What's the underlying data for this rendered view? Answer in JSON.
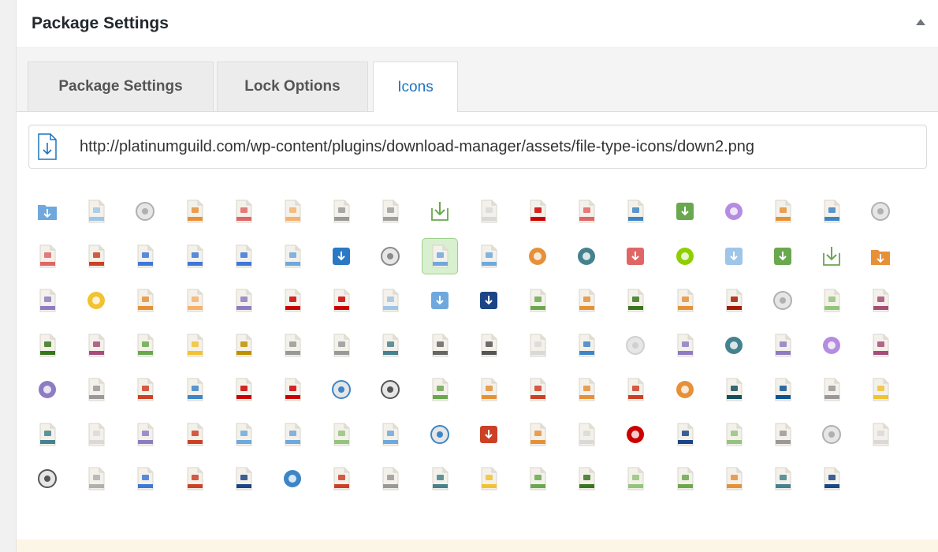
{
  "postbox": {
    "title": "Package Settings"
  },
  "tabs": [
    {
      "label": "Package Settings",
      "active": false
    },
    {
      "label": "Lock Options",
      "active": false
    },
    {
      "label": "Icons",
      "active": true
    }
  ],
  "icon_url": {
    "value": "http://platinumguild.com/wp-content/plugins/download-manager/assets/file-type-icons/down2.png"
  },
  "colors": {
    "accent": "#1e73be",
    "selected_bg": "#d8f0cf"
  },
  "file_icons": [
    {
      "name": "download-folder-icon",
      "shape": "folder",
      "color": "#6fa8dc"
    },
    {
      "name": "text-file-icon",
      "shape": "file",
      "color": "#9fc5e8"
    },
    {
      "name": "disc-icon",
      "shape": "disc",
      "color": "#b0b0b0"
    },
    {
      "name": "pdf-file-icon",
      "shape": "file",
      "color": "#e69138"
    },
    {
      "name": "acrobat-file-icon",
      "shape": "file",
      "color": "#e06666"
    },
    {
      "name": "ai-file-icon",
      "shape": "file",
      "color": "#f6b26b"
    },
    {
      "name": "lock-file-icon",
      "shape": "file",
      "color": "#999999"
    },
    {
      "name": "generic-file-icon",
      "shape": "file",
      "color": "#a0a0a0"
    },
    {
      "name": "download-arrow-icon",
      "shape": "arrow",
      "color": "#6aa84f"
    },
    {
      "name": "blank-file-icon",
      "shape": "file",
      "color": "#d9d9d9"
    },
    {
      "name": "red-media-file-icon",
      "shape": "file",
      "color": "#cc0000"
    },
    {
      "name": "asf-file-icon",
      "shape": "file",
      "color": "#e06666"
    },
    {
      "name": "image-file-icon",
      "shape": "file",
      "color": "#3d85c6"
    },
    {
      "name": "green-download-icon",
      "shape": "square",
      "color": "#6aa84f"
    },
    {
      "name": "cloud-icon",
      "shape": "circle",
      "color": "#b48ce0"
    },
    {
      "name": "code-file-icon",
      "shape": "file",
      "color": "#e69138"
    },
    {
      "name": "css-file-icon",
      "shape": "file",
      "color": "#3d85c6"
    },
    {
      "name": "disc-gray-icon",
      "shape": "disc",
      "color": "#b0b0b0"
    },
    {
      "name": "csv-file-icon",
      "shape": "file",
      "color": "#e06666"
    },
    {
      "name": "dbf-file-icon",
      "shape": "file",
      "color": "#cc4125"
    },
    {
      "name": "doc-file-icon",
      "shape": "file",
      "color": "#3c78d8"
    },
    {
      "name": "docx-file-icon",
      "shape": "file",
      "color": "#3c78d8"
    },
    {
      "name": "word-file-icon",
      "shape": "file",
      "color": "#3c78d8"
    },
    {
      "name": "dotx-file-icon",
      "shape": "file",
      "color": "#6fa8dc"
    },
    {
      "name": "w-logo-icon",
      "shape": "square",
      "color": "#2b78c5"
    },
    {
      "name": "database-icon",
      "shape": "disc",
      "color": "#8a8a8a"
    },
    {
      "name": "down-file-selected-icon",
      "shape": "file",
      "color": "#6fa8dc"
    },
    {
      "name": "download-box-icon",
      "shape": "file",
      "color": "#6fa8dc"
    },
    {
      "name": "download-circle-orange-icon",
      "shape": "circle",
      "color": "#e69138"
    },
    {
      "name": "download-circle-teal-icon",
      "shape": "circle",
      "color": "#45818e"
    },
    {
      "name": "download-red-icon",
      "shape": "square",
      "color": "#e06666"
    },
    {
      "name": "android-icon",
      "shape": "circle",
      "color": "#8fce00"
    },
    {
      "name": "monitor-download-icon",
      "shape": "square",
      "color": "#9fc5e8"
    },
    {
      "name": "green-box-icon",
      "shape": "square",
      "color": "#6aa84f"
    },
    {
      "name": "download-tray-icon",
      "shape": "arrow",
      "color": "#6aa84f"
    },
    {
      "name": "orange-folder-icon",
      "shape": "folder",
      "color": "#e69138"
    },
    {
      "name": "dwg-file-icon",
      "shape": "file",
      "color": "#8e7cc3"
    },
    {
      "name": "ring-icon",
      "shape": "circle",
      "color": "#f1c232"
    },
    {
      "name": "orange-square-file-icon",
      "shape": "file",
      "color": "#e69138"
    },
    {
      "name": "eps-file-icon",
      "shape": "file",
      "color": "#f6b26b"
    },
    {
      "name": "exe-file-icon",
      "shape": "file",
      "color": "#8e7cc3"
    },
    {
      "name": "flash-file-icon",
      "shape": "file",
      "color": "#cc0000"
    },
    {
      "name": "fla-file-icon",
      "shape": "file",
      "color": "#cc0000"
    },
    {
      "name": "flac-file-icon",
      "shape": "file",
      "color": "#9fc5e8"
    },
    {
      "name": "blue-gradient-icon",
      "shape": "square",
      "color": "#6fa8dc"
    },
    {
      "name": "info-box-icon",
      "shape": "square",
      "color": "#1c4587"
    },
    {
      "name": "check-file-icon",
      "shape": "file",
      "color": "#6aa84f"
    },
    {
      "name": "gif-file-icon",
      "shape": "file",
      "color": "#e69138"
    },
    {
      "name": "gnumeric-file-icon",
      "shape": "file",
      "color": "#38761d"
    },
    {
      "name": "html-file-icon",
      "shape": "file",
      "color": "#e69138"
    },
    {
      "name": "indesign-file-icon",
      "shape": "file",
      "color": "#a61c00"
    },
    {
      "name": "iso-disc-icon",
      "shape": "disc",
      "color": "#b0b0b0"
    },
    {
      "name": "iso-file-icon",
      "shape": "file",
      "color": "#93c47d"
    },
    {
      "name": "jar-file-icon",
      "shape": "file",
      "color": "#a64d79"
    },
    {
      "name": "jpeg-file-icon",
      "shape": "file",
      "color": "#38761d"
    },
    {
      "name": "camera-file-icon",
      "shape": "file",
      "color": "#a64d79"
    },
    {
      "name": "jpg-file-icon",
      "shape": "file",
      "color": "#6aa84f"
    },
    {
      "name": "js-file-icon",
      "shape": "file",
      "color": "#f1c232"
    },
    {
      "name": "json-file-icon",
      "shape": "file",
      "color": "#bf9000"
    },
    {
      "name": "json2-file-icon",
      "shape": "file",
      "color": "#999999"
    },
    {
      "name": "key-file-icon",
      "shape": "file",
      "color": "#999999"
    },
    {
      "name": "kml-file-icon",
      "shape": "file",
      "color": "#45818e"
    },
    {
      "name": "m4v-file-icon",
      "shape": "file",
      "color": "#666666"
    },
    {
      "name": "music-file-icon",
      "shape": "file",
      "color": "#555555"
    },
    {
      "name": "music-blank-file-icon",
      "shape": "file",
      "color": "#d9d9d9"
    },
    {
      "name": "search-file-icon",
      "shape": "file",
      "color": "#3d85c6"
    },
    {
      "name": "disc-light-icon",
      "shape": "disc",
      "color": "#d0d0d0"
    },
    {
      "name": "mp3-file-icon",
      "shape": "file",
      "color": "#8e7cc3"
    },
    {
      "name": "headphones-icon",
      "shape": "circle",
      "color": "#45818e"
    },
    {
      "name": "mp4-file-icon",
      "shape": "file",
      "color": "#8e7cc3"
    },
    {
      "name": "film-reel-icon",
      "shape": "circle",
      "color": "#b48ce0"
    },
    {
      "name": "mpeg-file-icon",
      "shape": "file",
      "color": "#a64d79"
    },
    {
      "name": "film-reel-purple-icon",
      "shape": "circle",
      "color": "#8e7cc3"
    },
    {
      "name": "mov-file-icon",
      "shape": "file",
      "color": "#999999"
    },
    {
      "name": "msg-file-icon",
      "shape": "file",
      "color": "#cc4125"
    },
    {
      "name": "pdf-download-icon",
      "shape": "file",
      "color": "#3d85c6"
    },
    {
      "name": "pdf-red-file-icon",
      "shape": "file",
      "color": "#cc0000"
    },
    {
      "name": "pdf-acrobat-file-icon",
      "shape": "file",
      "color": "#cc0000"
    },
    {
      "name": "gear-blue-icon",
      "shape": "disc",
      "color": "#3d85c6"
    },
    {
      "name": "gear-dark-icon",
      "shape": "disc",
      "color": "#555555"
    },
    {
      "name": "png-file-icon",
      "shape": "file",
      "color": "#6aa84f"
    },
    {
      "name": "pps-file-icon",
      "shape": "file",
      "color": "#e69138"
    },
    {
      "name": "ppt-file-icon",
      "shape": "file",
      "color": "#cc4125"
    },
    {
      "name": "pptx-file-icon",
      "shape": "file",
      "color": "#e69138"
    },
    {
      "name": "pptx2-file-icon",
      "shape": "file",
      "color": "#cc4125"
    },
    {
      "name": "question-icon",
      "shape": "circle",
      "color": "#e69138"
    },
    {
      "name": "psd-file-icon",
      "shape": "file",
      "color": "#134f5c"
    },
    {
      "name": "ps-blue-file-icon",
      "shape": "file",
      "color": "#0b5394"
    },
    {
      "name": "psd2-file-icon",
      "shape": "file",
      "color": "#999999"
    },
    {
      "name": "eye-file-icon",
      "shape": "file",
      "color": "#f1c232"
    },
    {
      "name": "publisher-file-icon",
      "shape": "file",
      "color": "#45818e"
    },
    {
      "name": "rar-file-icon",
      "shape": "file",
      "color": "#d9d9d9"
    },
    {
      "name": "purple-file-icon",
      "shape": "file",
      "color": "#8e7cc3"
    },
    {
      "name": "rar2-file-icon",
      "shape": "file",
      "color": "#cc4125"
    },
    {
      "name": "rtf-file-icon",
      "shape": "file",
      "color": "#6fa8dc"
    },
    {
      "name": "person-download-icon",
      "shape": "file",
      "color": "#6fa8dc"
    },
    {
      "name": "sheet-file-icon",
      "shape": "file",
      "color": "#93c47d"
    },
    {
      "name": "sql-file-icon",
      "shape": "file",
      "color": "#6fa8dc"
    },
    {
      "name": "gear-light-blue-icon",
      "shape": "disc",
      "color": "#3d85c6"
    },
    {
      "name": "swf-file-icon",
      "shape": "square",
      "color": "#cc4125"
    },
    {
      "name": "svg-file-icon",
      "shape": "file",
      "color": "#e69138"
    },
    {
      "name": "txt-file-icon",
      "shape": "file",
      "color": "#d9d9d9"
    },
    {
      "name": "record-icon",
      "shape": "circle",
      "color": "#cc0000"
    },
    {
      "name": "tif-file-icon",
      "shape": "file",
      "color": "#1c4587"
    },
    {
      "name": "text-green-file-icon",
      "shape": "file",
      "color": "#93c47d"
    },
    {
      "name": "tmp-file-icon",
      "shape": "file",
      "color": "#999999"
    },
    {
      "name": "disc-white-icon",
      "shape": "disc",
      "color": "#b0b0b0"
    },
    {
      "name": "vcf-file-icon",
      "shape": "file",
      "color": "#d9d9d9"
    },
    {
      "name": "vob-disc-icon",
      "shape": "disc",
      "color": "#555555"
    },
    {
      "name": "video-file-icon",
      "shape": "file",
      "color": "#b0b0b0"
    },
    {
      "name": "wav-file-icon",
      "shape": "file",
      "color": "#3c78d8"
    },
    {
      "name": "wave-file-icon",
      "shape": "file",
      "color": "#cc4125"
    },
    {
      "name": "wma-file-icon",
      "shape": "file",
      "color": "#1c4587"
    },
    {
      "name": "globe-icon",
      "shape": "circle",
      "color": "#3d85c6"
    },
    {
      "name": "speaker-file-icon",
      "shape": "file",
      "color": "#cc4125"
    },
    {
      "name": "wpd-file-icon",
      "shape": "file",
      "color": "#999999"
    },
    {
      "name": "wps-file-icon",
      "shape": "file",
      "color": "#45818e"
    },
    {
      "name": "zip-yellow-file-icon",
      "shape": "file",
      "color": "#f1c232"
    },
    {
      "name": "excel-file-icon",
      "shape": "file",
      "color": "#6aa84f"
    },
    {
      "name": "excel-x-icon",
      "shape": "file",
      "color": "#38761d"
    },
    {
      "name": "xls-file-icon",
      "shape": "file",
      "color": "#93c47d"
    },
    {
      "name": "xlsx-file-icon",
      "shape": "file",
      "color": "#6aa84f"
    },
    {
      "name": "xml-file-icon",
      "shape": "file",
      "color": "#e69138"
    },
    {
      "name": "zipper-icon",
      "shape": "file",
      "color": "#45818e"
    },
    {
      "name": "zip-file-icon",
      "shape": "file",
      "color": "#1c4587"
    }
  ],
  "selected_icon_index": 26
}
